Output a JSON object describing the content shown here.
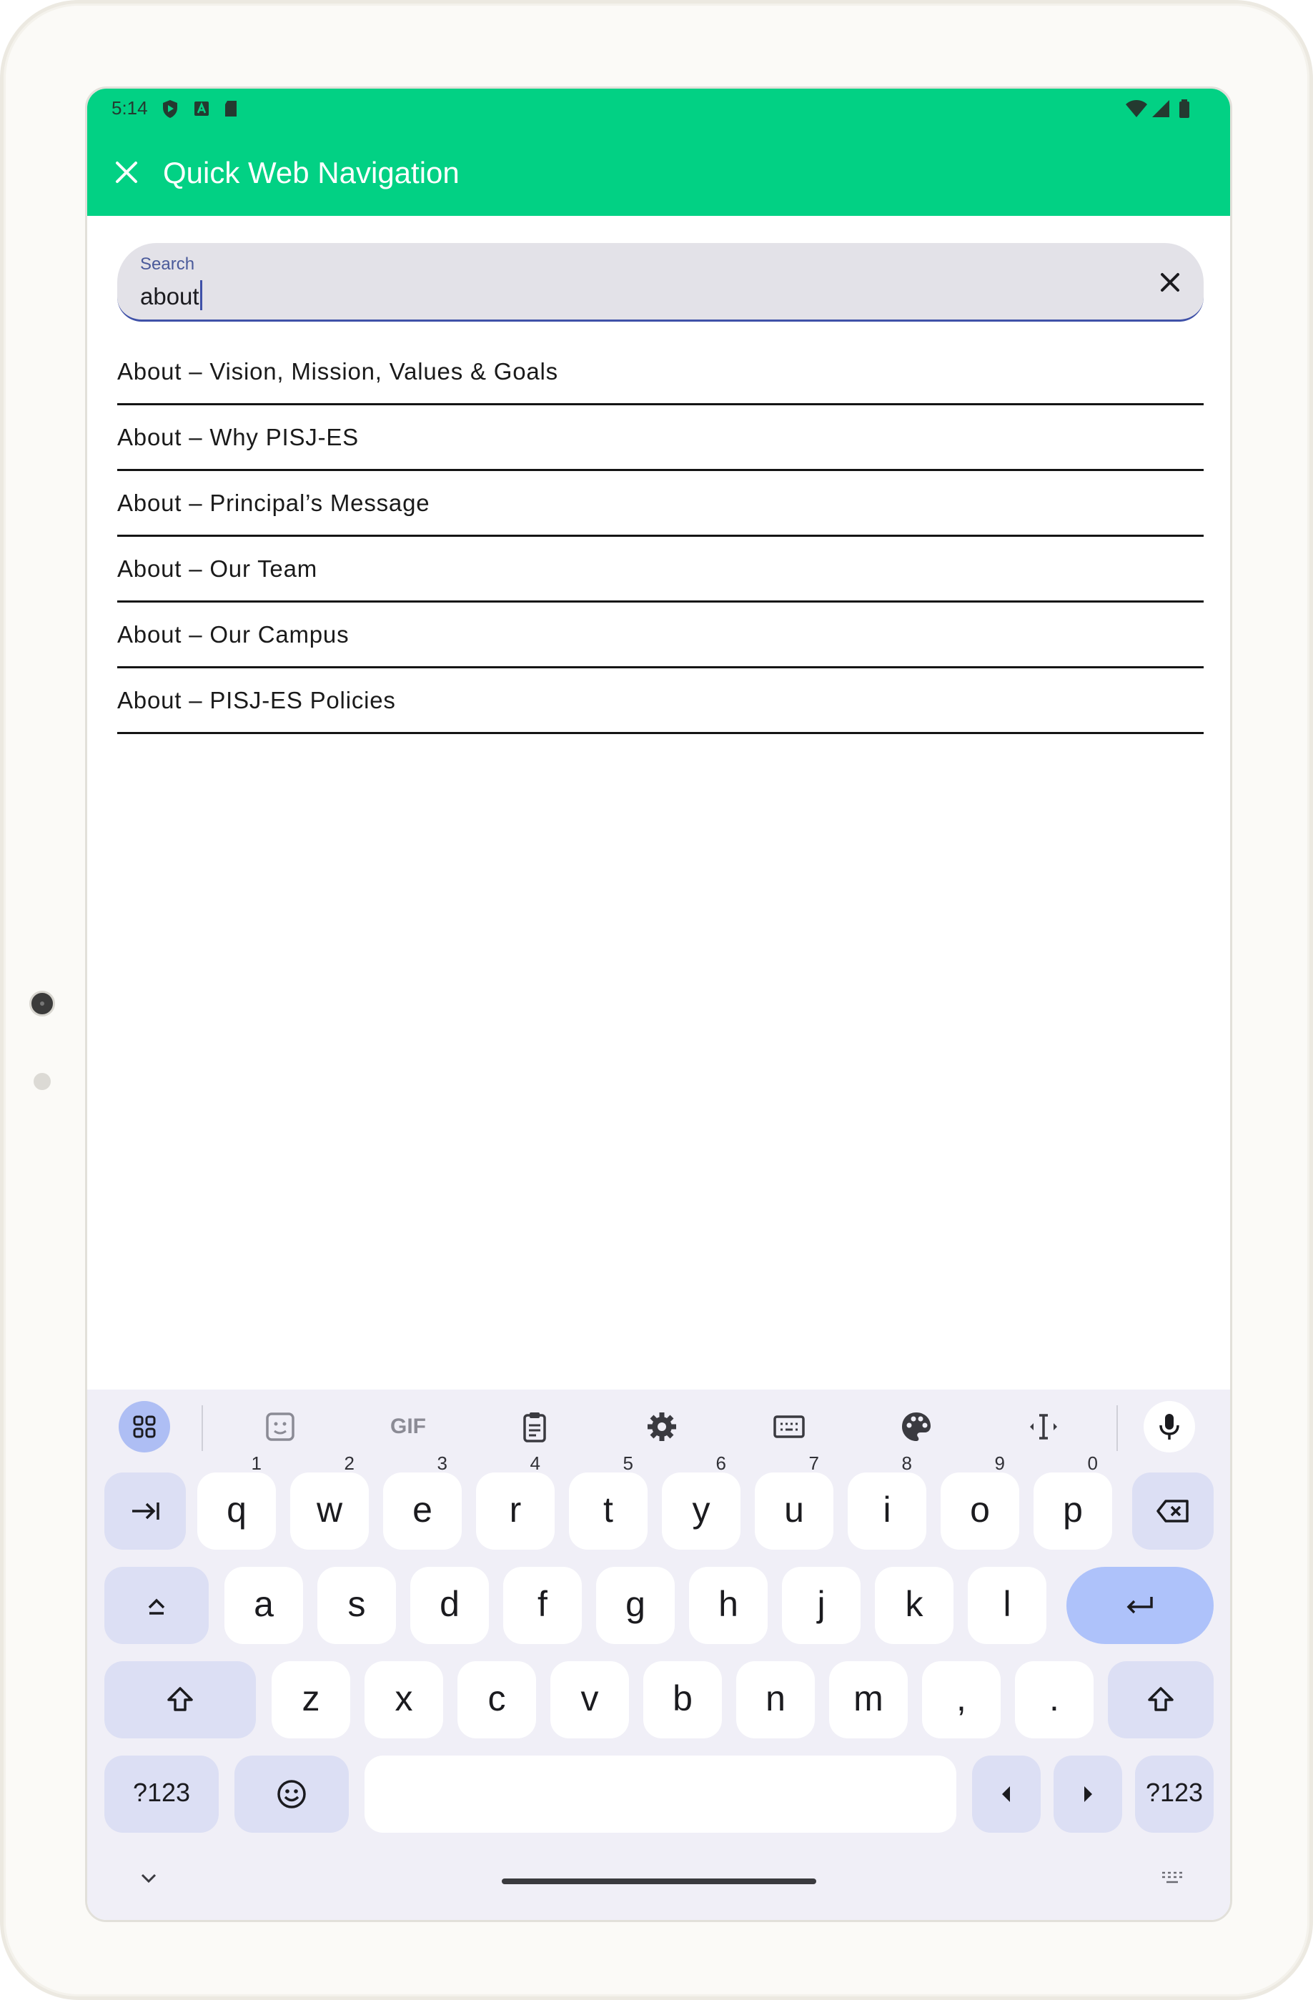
{
  "status_bar": {
    "time": "5:14"
  },
  "app_bar": {
    "title": "Quick Web Navigation"
  },
  "search": {
    "label": "Search",
    "value": "about"
  },
  "results": [
    "About – Vision, Mission, Values & Goals",
    "About – Why PISJ-ES",
    "About – Principal’s Message",
    "About – Our Team",
    "About – Our Campus",
    "About – PISJ-ES Policies"
  ],
  "keyboard": {
    "toolbar_icons": [
      "apps-icon",
      "sticker-icon",
      "gif-icon",
      "clipboard-icon",
      "settings-icon",
      "one-handed-keyboard-icon",
      "theme-palette-icon",
      "text-cursor-icon",
      "mic-icon"
    ],
    "gif_label": "GIF",
    "row1": [
      {
        "key": "q",
        "hint": "1"
      },
      {
        "key": "w",
        "hint": "2"
      },
      {
        "key": "e",
        "hint": "3"
      },
      {
        "key": "r",
        "hint": "4"
      },
      {
        "key": "t",
        "hint": "5"
      },
      {
        "key": "y",
        "hint": "6"
      },
      {
        "key": "u",
        "hint": "7"
      },
      {
        "key": "i",
        "hint": "8"
      },
      {
        "key": "o",
        "hint": "9"
      },
      {
        "key": "p",
        "hint": "0"
      }
    ],
    "row2": [
      "a",
      "s",
      "d",
      "f",
      "g",
      "h",
      "j",
      "k",
      "l"
    ],
    "row3": [
      "z",
      "x",
      "c",
      "v",
      "b",
      "n",
      "m",
      ",",
      "."
    ],
    "symbols_label": "?123",
    "accent_color": "#02d184"
  }
}
